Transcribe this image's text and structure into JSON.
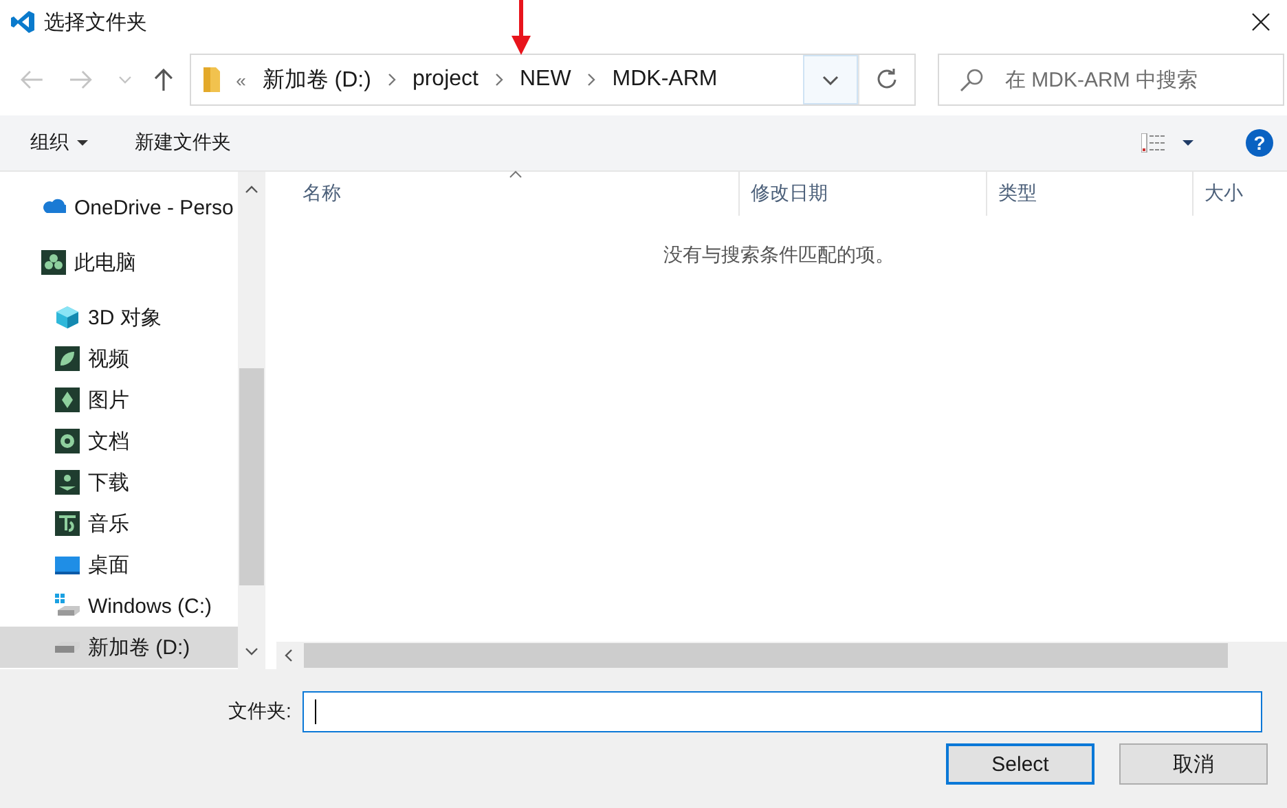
{
  "window": {
    "title": "选择文件夹"
  },
  "address": {
    "overflow": "«",
    "crumbs": [
      "新加卷 (D:)",
      "project",
      "NEW",
      "MDK-ARM"
    ]
  },
  "search": {
    "placeholder": "在 MDK-ARM 中搜索"
  },
  "toolbar": {
    "organize": "组织",
    "new_folder": "新建文件夹",
    "help": "?"
  },
  "sidebar": {
    "items": [
      {
        "label": "OneDrive - Perso",
        "kind": "cloud",
        "selected": false
      },
      {
        "label": "此电脑",
        "kind": "pc",
        "selected": false,
        "children": [
          {
            "label": "3D 对象",
            "kind": "cube",
            "selected": false
          },
          {
            "label": "视频",
            "kind": "video",
            "selected": false
          },
          {
            "label": "图片",
            "kind": "picture",
            "selected": false
          },
          {
            "label": "文档",
            "kind": "doc",
            "selected": false
          },
          {
            "label": "下载",
            "kind": "download",
            "selected": false
          },
          {
            "label": "音乐",
            "kind": "music",
            "selected": false
          },
          {
            "label": "桌面",
            "kind": "desktop",
            "selected": false
          },
          {
            "label": "Windows (C:)",
            "kind": "systemdrive",
            "selected": false
          },
          {
            "label": "新加卷 (D:)",
            "kind": "drive",
            "selected": true
          }
        ]
      }
    ]
  },
  "table": {
    "columns": [
      "名称",
      "修改日期",
      "类型",
      "大小"
    ],
    "empty_message": "没有与搜索条件匹配的项。"
  },
  "footer": {
    "folder_label": "文件夹:",
    "buttons": [
      {
        "label": "Select",
        "default": true
      },
      {
        "label": "取消",
        "default": false
      }
    ]
  }
}
